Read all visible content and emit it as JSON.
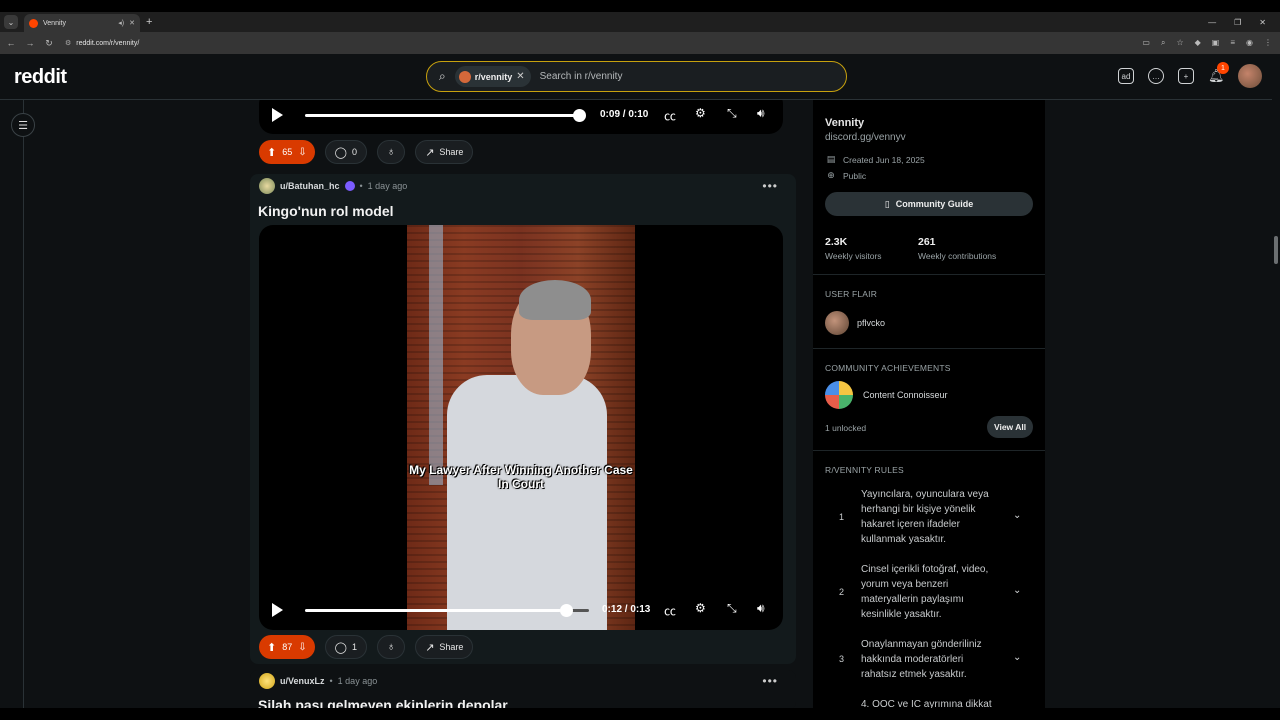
{
  "browser": {
    "tab_title": "Vennity",
    "url": "reddit.com/r/vennity/"
  },
  "header": {
    "logo": "reddit",
    "search_chip": "r/vennity",
    "search_placeholder": "Search in r/vennity",
    "notification_count": "1"
  },
  "post_top": {
    "time": "0:09 / 0:10",
    "progress": 0.98,
    "upvotes": "65",
    "comments": "0",
    "share_label": "Share"
  },
  "post_main": {
    "author": "u/Batuhan_hc",
    "age": "1 day ago",
    "title": "Kingo'nun rol model",
    "video_caption": "My Lawyer After Winning Another Case In Court",
    "time": "0:12 / 0:13",
    "progress": 0.92,
    "upvotes": "87",
    "comments": "1",
    "share_label": "Share"
  },
  "post_next": {
    "author": "u/VenuxLz",
    "age": "1 day ago",
    "title": "Silah pası gelmeyen ekiplerin depolar"
  },
  "sidebar": {
    "name": "Vennity",
    "link": "discord.gg/vennyv",
    "created": "Created Jun 18, 2025",
    "visibility": "Public",
    "guide_label": "Community Guide",
    "visitors_num": "2.3K",
    "visitors_lbl": "Weekly visitors",
    "contrib_num": "261",
    "contrib_lbl": "Weekly contributions",
    "flair_head": "USER FLAIR",
    "flair_name": "pflvcko",
    "ach_head": "COMMUNITY ACHIEVEMENTS",
    "ach_name": "Content Connoisseur",
    "unlocked": "1 unlocked",
    "view_all": "View All",
    "rules_head": "R/VENNITY RULES",
    "rules": [
      {
        "num": "1",
        "text": "Yayıncılara, oyunculara veya herhangi bir kişiye yönelik hakaret içeren ifadeler kullanmak yasaktır."
      },
      {
        "num": "2",
        "text": "Cinsel içerikli fotoğraf, video, yorum veya benzeri materyallerin paylaşımı kesinlikle yasaktır."
      },
      {
        "num": "3",
        "text": "Onaylanmayan gönderiliniz hakkında moderatörleri rahatsız etmek yasaktır."
      }
    ],
    "rule4_partial": "4. OOC ve IC ayrımına dikkat"
  }
}
